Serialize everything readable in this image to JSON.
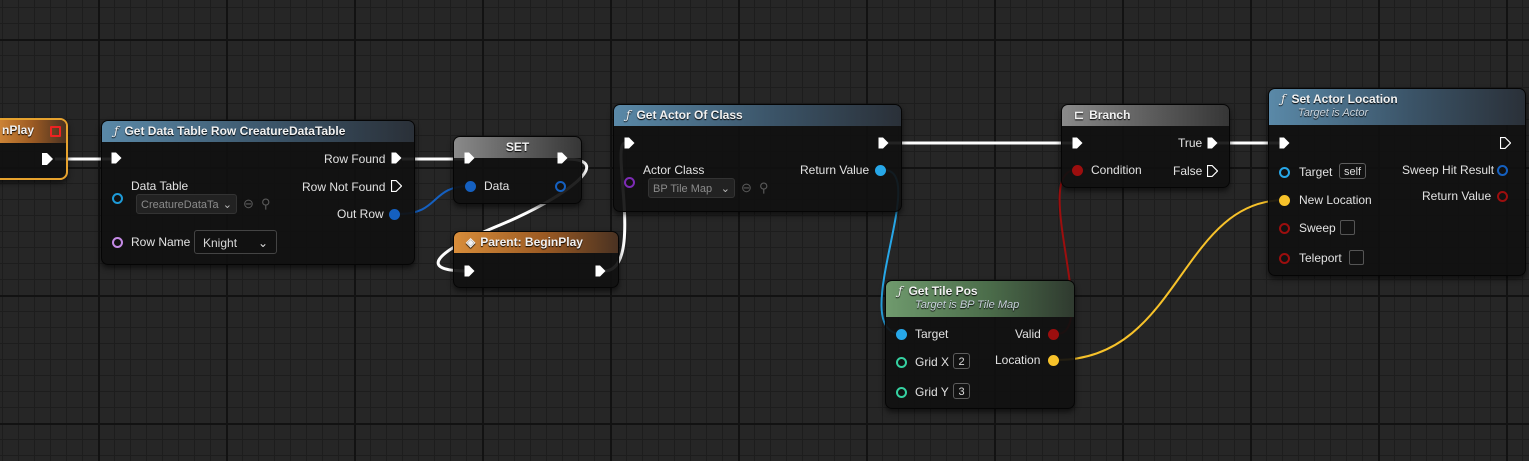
{
  "colors": {
    "exec": "#ffffff",
    "table_pin": "#1e9bd8",
    "struct_pin": "#1560c0",
    "name_pin": "#c58ae6",
    "class_pin": "#7d2bb5",
    "object_pin": "#27a7e8",
    "bool_pin": "#9c0e0e",
    "int_pin": "#35d1a1",
    "vector_pin": "#f7c22a"
  },
  "nodes": {
    "begin_play": {
      "title": "nPlay",
      "icons": {
        "delegate": "delegate-square-icon",
        "exec_out": "exec-out-pin-icon"
      }
    },
    "get_row": {
      "title": "Get Data Table Row CreatureDataTable",
      "icon": "function-icon",
      "pins": {
        "row_found": "Row Found",
        "row_not_found": "Row Not Found",
        "out_row": "Out Row",
        "data_table": "Data Table",
        "data_table_value": "CreatureDataTa",
        "row_name": "Row Name",
        "row_name_value": "Knight"
      }
    },
    "set": {
      "title": "SET",
      "pins": {
        "data": "Data"
      }
    },
    "parent_begin": {
      "title": "Parent: BeginPlay",
      "icon": "event-diamond-icon"
    },
    "get_actor": {
      "title": "Get Actor Of Class",
      "icon": "function-icon",
      "pins": {
        "actor_class": "Actor Class",
        "actor_class_value": "BP Tile Map",
        "return_value": "Return Value"
      }
    },
    "branch": {
      "title": "Branch",
      "icon": "branch-icon",
      "pins": {
        "true": "True",
        "false": "False",
        "condition": "Condition"
      }
    },
    "set_location": {
      "title": "Set Actor Location",
      "subtitle": "Target is Actor",
      "icon": "function-icon",
      "pins": {
        "target": "Target",
        "target_value": "self",
        "new_location": "New Location",
        "sweep": "Sweep",
        "teleport": "Teleport",
        "sweep_hit": "Sweep Hit Result",
        "return_value": "Return Value"
      }
    },
    "tile_pos": {
      "title": "Get Tile Pos",
      "subtitle": "Target is BP Tile Map",
      "icon": "function-icon",
      "pins": {
        "target": "Target",
        "grid_x": "Grid X",
        "grid_x_value": "2",
        "grid_y": "Grid Y",
        "grid_y_value": "3",
        "valid": "Valid",
        "location": "Location"
      }
    }
  }
}
